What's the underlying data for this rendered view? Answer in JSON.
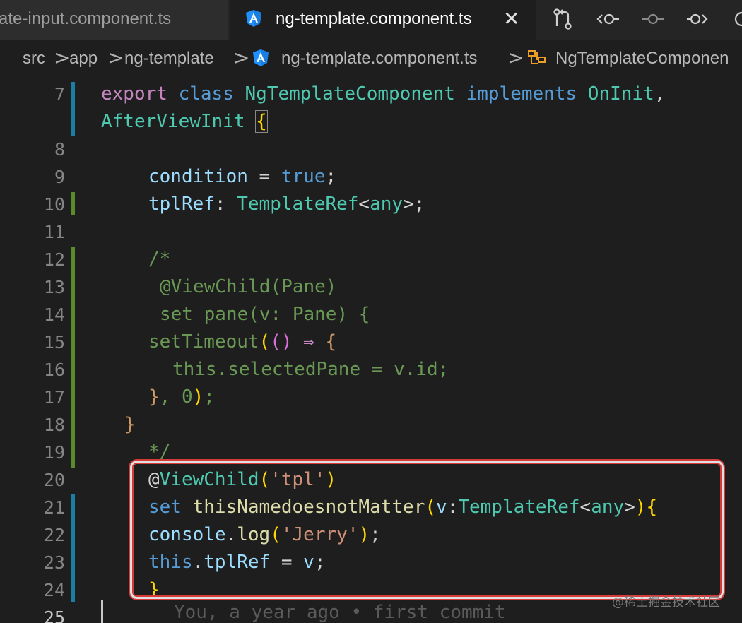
{
  "tabs": [
    {
      "label": "ate-input.component.ts",
      "active": false
    },
    {
      "label": "ng-template.component.ts",
      "active": true
    }
  ],
  "toolbar": {
    "icons": [
      "source-control-compare-icon",
      "timeline-back-icon",
      "timeline-dot-icon",
      "timeline-forward-icon",
      "circle-icon"
    ],
    "close_glyph": "✕"
  },
  "breadcrumb": {
    "items": [
      "src",
      "app",
      "ng-template",
      "ng-template.component.ts",
      "NgTemplateComponen"
    ],
    "separator": ">"
  },
  "editor": {
    "line_numbers": [
      "7",
      "",
      "8",
      "9",
      "10",
      "11",
      "12",
      "13",
      "14",
      "15",
      "16",
      "17",
      "18",
      "19",
      "20",
      "21",
      "22",
      "23",
      "24",
      "25"
    ],
    "current_line": "25",
    "blame": "You, a year ago • first commit"
  },
  "code": {
    "export": "export",
    "class": "class",
    "name": "NgTemplateComponent",
    "implements": "implements",
    "onInit": "OnInit",
    "comma": ",",
    "afterViewInit": "AfterViewInit",
    "brace": "{",
    "condition": "condition",
    "eq": " = ",
    "true": "true",
    "semi": ";",
    "tplRef": "tplRef",
    "colon": ": ",
    "templateRef": "TemplateRef",
    "lt": "<",
    "any": "any",
    "gt": ">",
    "c1": "/*",
    "c2": "@ViewChild(Pane)",
    "c3": "set pane(v: Pane) {",
    "setTimeout": "setTimeout",
    "paren_open": "(",
    "paren_close": ")",
    "arrow": " ⇒ ",
    "assign": "this.selectedPane = v.id;",
    "close_brace": "}",
    "comma_sp": ", ",
    "zero": "0",
    "close_paren": ")",
    "c_end": "*/",
    "at": "@",
    "viewChild": "ViewChild",
    "tpl_str": "'tpl'",
    "set": "set",
    "setterName": "thisNamedoesnotMatter",
    "v": "v",
    "colon_nosp": ":",
    "console": "console",
    "dot": ".",
    "log": "log",
    "jerry_str": "'Jerry'",
    "this": "this",
    "eq_v": " = ",
    "v2": "v"
  },
  "watermark": "@稀土掘金技术社区",
  "colors": {
    "accent_highlight": "#d83a3a",
    "angular": "#1e90ff",
    "modified_bar": "#1b7fa3",
    "added_bar": "#5a8a2a"
  }
}
